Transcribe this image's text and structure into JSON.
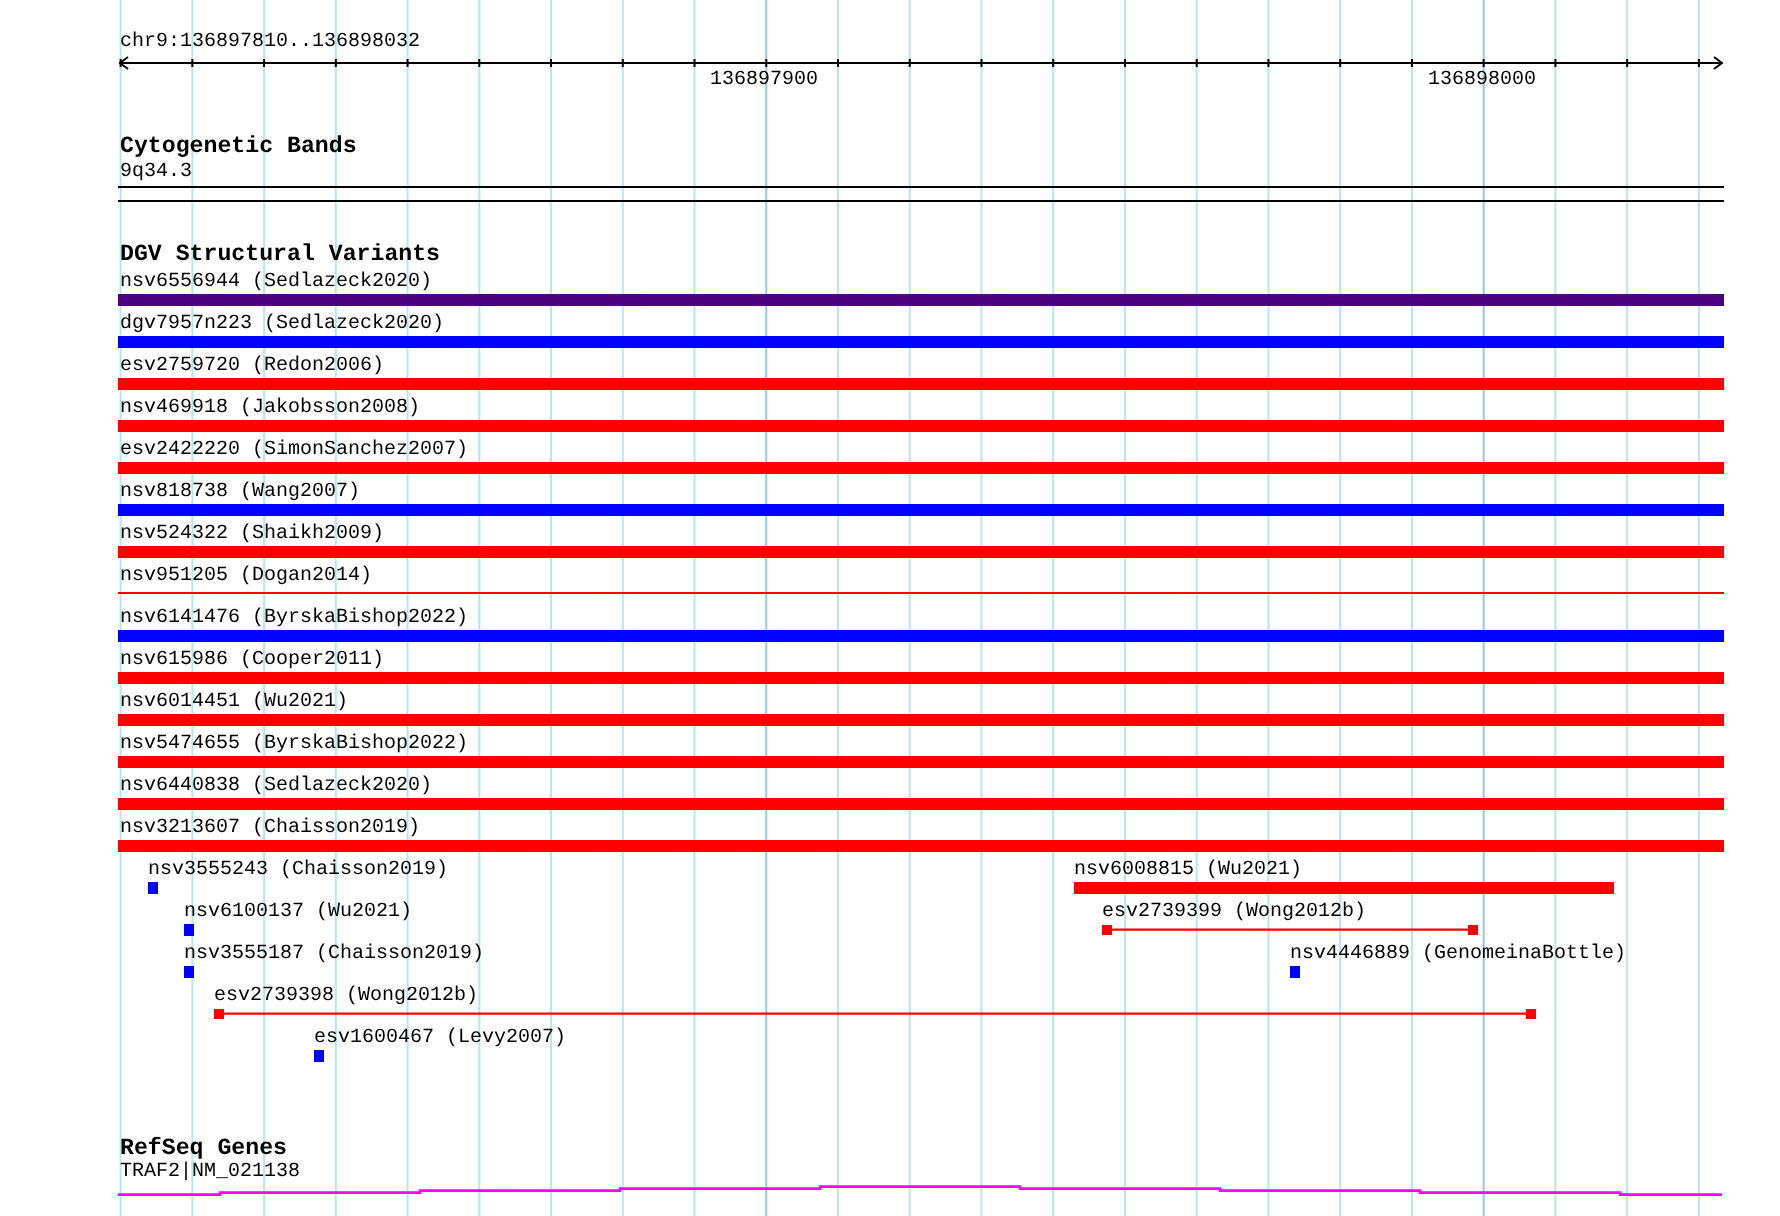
{
  "ruler": {
    "location": "chr9:136897810..136898032",
    "tick_labels": [
      "136897900",
      "136898000"
    ]
  },
  "cytogenetic_bands": {
    "title": "Cytogenetic Bands",
    "bands": [
      {
        "label": "9q34.3"
      }
    ]
  },
  "dgv_track": {
    "title": "DGV Structural Variants",
    "spanning_features": [
      {
        "label": "nsv6556944 (Sedlazeck2020)",
        "kind": "bar",
        "color": "#4b0082"
      },
      {
        "label": "dgv7957n223 (Sedlazeck2020)",
        "kind": "bar",
        "color": "#0000ff"
      },
      {
        "label": "esv2759720 (Redon2006)",
        "kind": "bar",
        "color": "#ff0000"
      },
      {
        "label": "nsv469918 (Jakobsson2008)",
        "kind": "bar",
        "color": "#ff0000"
      },
      {
        "label": "esv2422220 (SimonSanchez2007)",
        "kind": "bar",
        "color": "#ff0000"
      },
      {
        "label": "nsv818738 (Wang2007)",
        "kind": "bar",
        "color": "#0000ff"
      },
      {
        "label": "nsv524322 (Shaikh2009)",
        "kind": "bar",
        "color": "#ff0000"
      },
      {
        "label": "nsv951205 (Dogan2014)",
        "kind": "line",
        "color": "#ff0000"
      },
      {
        "label": "nsv6141476 (ByrskaBishop2022)",
        "kind": "bar",
        "color": "#0000ff"
      },
      {
        "label": "nsv615986 (Cooper2011)",
        "kind": "bar",
        "color": "#ff0000"
      },
      {
        "label": "nsv6014451 (Wu2021)",
        "kind": "bar",
        "color": "#ff0000"
      },
      {
        "label": "nsv5474655 (ByrskaBishop2022)",
        "kind": "bar",
        "color": "#ff0000"
      },
      {
        "label": "nsv6440838 (Sedlazeck2020)",
        "kind": "bar",
        "color": "#ff0000"
      },
      {
        "label": "nsv3213607 (Chaisson2019)",
        "kind": "bar",
        "color": "#ff0000"
      }
    ],
    "local_features": [
      {
        "label": "nsv3555243 (Chaisson2019)",
        "kind": "bar",
        "color": "#0000ff"
      },
      {
        "label": "nsv6008815 (Wu2021)",
        "kind": "bar",
        "color": "#ff0000"
      },
      {
        "label": "nsv6100137 (Wu2021)",
        "kind": "bar",
        "color": "#0000ff"
      },
      {
        "label": "esv2739399 (Wong2012b)",
        "kind": "span",
        "color": "#ff0000"
      },
      {
        "label": "nsv3555187 (Chaisson2019)",
        "kind": "bar",
        "color": "#0000ff"
      },
      {
        "label": "nsv4446889 (GenomeinaBottle)",
        "kind": "bar",
        "color": "#0000ff"
      },
      {
        "label": "esv2739398 (Wong2012b)",
        "kind": "span",
        "color": "#ff0000"
      },
      {
        "label": "esv1600467 (Levy2007)",
        "kind": "bar",
        "color": "#0000ff"
      }
    ]
  },
  "refseq_genes": {
    "title": "RefSeq Genes",
    "genes": [
      {
        "label": "TRAF2|NM_021138"
      }
    ]
  }
}
